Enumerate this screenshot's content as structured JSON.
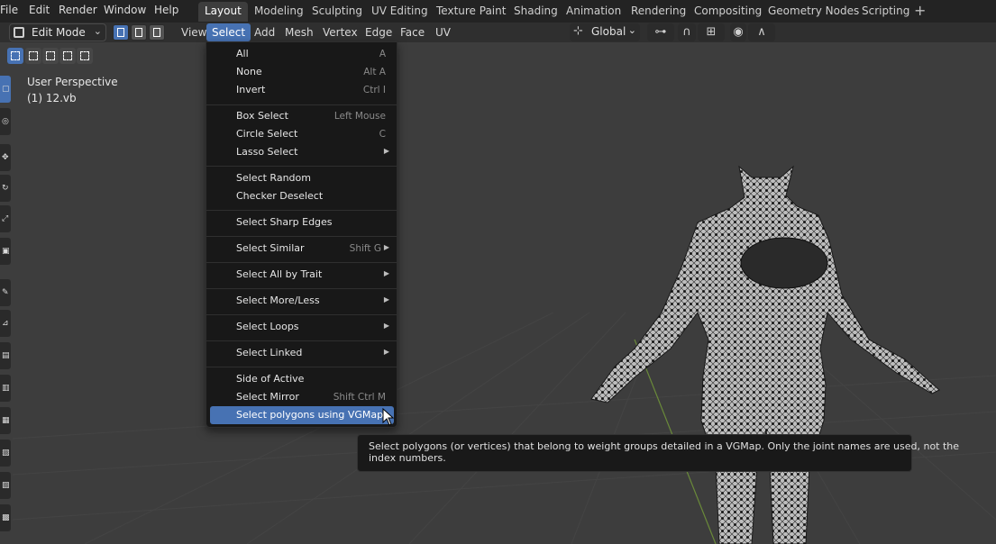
{
  "top_menu": [
    "File",
    "Edit",
    "Render",
    "Window",
    "Help"
  ],
  "workspaces": [
    {
      "label": "Layout",
      "active": true
    },
    {
      "label": "Modeling"
    },
    {
      "label": "Sculpting"
    },
    {
      "label": "UV Editing"
    },
    {
      "label": "Texture Paint"
    },
    {
      "label": "Shading"
    },
    {
      "label": "Animation"
    },
    {
      "label": "Rendering"
    },
    {
      "label": "Compositing"
    },
    {
      "label": "Geometry Nodes"
    },
    {
      "label": "Scripting"
    }
  ],
  "header": {
    "mode": "Edit Mode",
    "menus": [
      "View",
      "Select",
      "Add",
      "Mesh",
      "Vertex",
      "Edge",
      "Face",
      "UV"
    ],
    "active_menu": "Select",
    "orientation": "Global"
  },
  "viewport": {
    "perspective_label": "User Perspective",
    "object_label": "(1) 12.vb"
  },
  "select_menu": {
    "items": [
      {
        "label": "All",
        "shortcut": "A"
      },
      {
        "label": "None",
        "shortcut": "Alt A"
      },
      {
        "label": "Invert",
        "shortcut": "Ctrl I"
      },
      {
        "label": "Box Select",
        "shortcut": "Left Mouse"
      },
      {
        "label": "Circle Select",
        "shortcut": "C"
      },
      {
        "label": "Lasso Select",
        "submenu": true
      },
      {
        "label": "Select Random"
      },
      {
        "label": "Checker Deselect"
      },
      {
        "label": "Select Sharp Edges"
      },
      {
        "label": "Select Similar",
        "shortcut": "Shift G",
        "submenu": true
      },
      {
        "label": "Select All by Trait",
        "submenu": true
      },
      {
        "label": "Select More/Less",
        "submenu": true
      },
      {
        "label": "Select Loops",
        "submenu": true
      },
      {
        "label": "Select Linked",
        "submenu": true
      },
      {
        "label": "Side of Active"
      },
      {
        "label": "Select Mirror",
        "shortcut": "Shift Ctrl M"
      },
      {
        "label": "Select polygons using VGMap",
        "highlighted": true
      }
    ]
  },
  "tooltip": {
    "line1": "Select polygons (or vertices) that belong to weight groups detailed in a VGMap.  Only the joint names are used, not the",
    "line2": "index numbers."
  },
  "colors": {
    "accent": "#4772b3",
    "background": "#3d3d3d",
    "menu_bg": "#181818"
  }
}
